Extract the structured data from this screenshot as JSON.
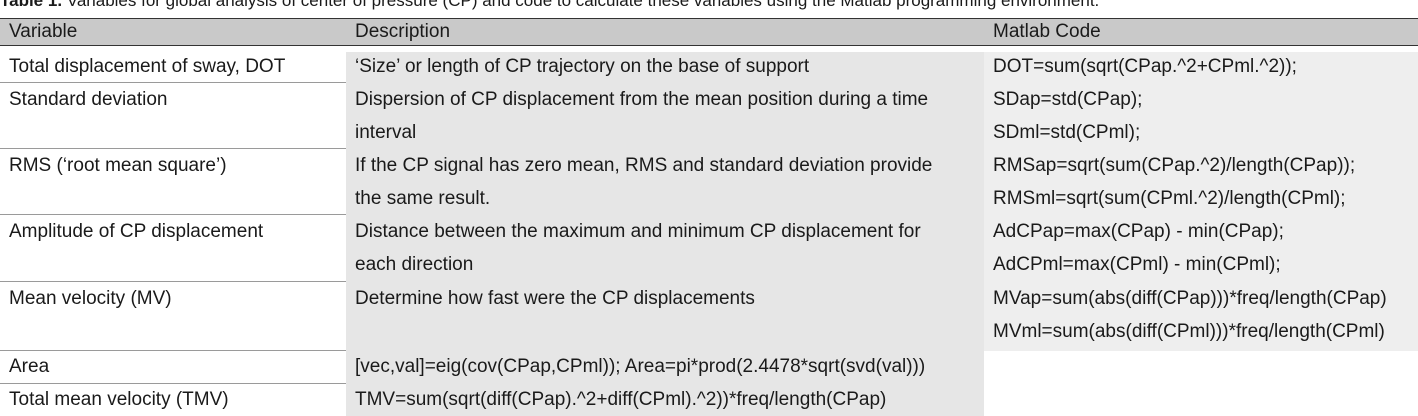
{
  "caption": {
    "lead": "Table 1.",
    "text": " Variables for global analysis of center of pressure (CP) and code to calculate these variables using the Matlab programming environment."
  },
  "table": {
    "headers": [
      "Variable",
      "Description",
      "Matlab Code"
    ],
    "rows": [
      {
        "variable": "Total displacement of sway, DOT",
        "description": [
          "‘Size’ or length of CP trajectory on the base of support"
        ],
        "code": [
          "DOT=sum(sqrt(CPap.^2+CPml.^2));"
        ]
      },
      {
        "variable": "Standard deviation",
        "description": [
          "Dispersion of CP displacement from the mean position during a time",
          "interval"
        ],
        "code": [
          "SDap=std(CPap);",
          "SDml=std(CPml);"
        ]
      },
      {
        "variable": "RMS (‘root mean square’)",
        "description": [
          "If the CP signal has zero mean, RMS and standard deviation provide",
          "the same result."
        ],
        "code": [
          "RMSap=sqrt(sum(CPap.^2)/length(CPap));",
          "RMSml=sqrt(sum(CPml.^2)/length(CPml);"
        ]
      },
      {
        "variable": "Amplitude of CP displacement",
        "description": [
          "Distance between the maximum and minimum CP displacement for",
          "each direction"
        ],
        "code": [
          "AdCPap=max(CPap) - min(CPap);",
          "AdCPml=max(CPml) - min(CPml);"
        ]
      },
      {
        "variable": "Mean velocity (MV)",
        "description": [
          "Determine how fast were the CP displacements"
        ],
        "code": [
          "MVap=sum(abs(diff(CPap)))*freq/length(CPap)",
          "MVml=sum(abs(diff(CPml)))*freq/length(CPml)"
        ]
      },
      {
        "variable": "Area",
        "description": [
          "[vec,val]=eig(cov(CPap,CPml)); Area=pi*prod(2.4478*sqrt(svd(val)))"
        ],
        "code": []
      },
      {
        "variable": "Total mean velocity (TMV)",
        "description": [
          "TMV=sum(sqrt(diff(CPap).^2+diff(CPml).^2))*freq/length(CPap)"
        ],
        "code": []
      }
    ]
  }
}
